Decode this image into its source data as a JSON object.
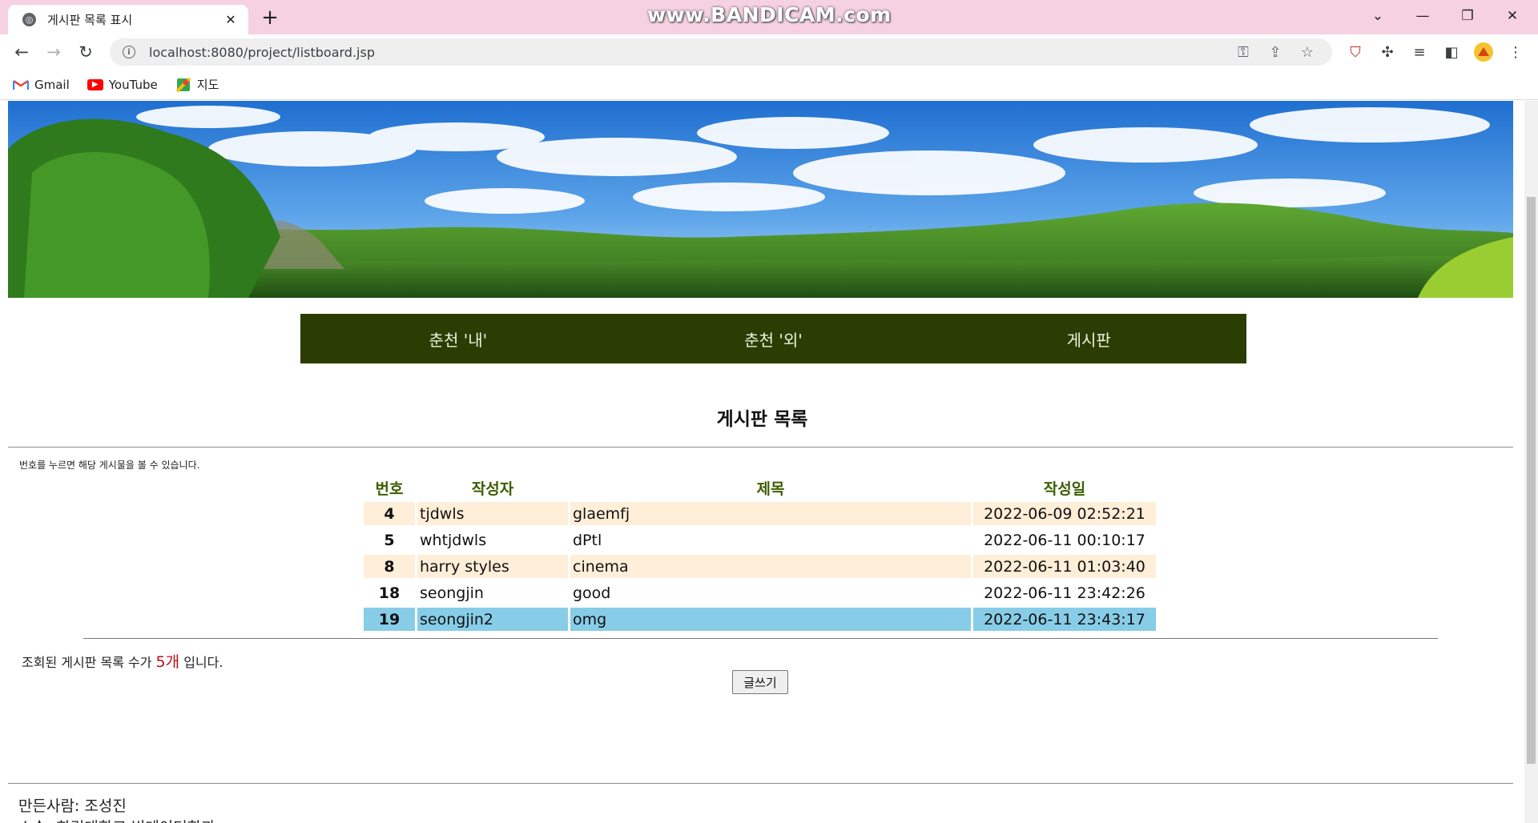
{
  "browser": {
    "tab_title": "게시판 목록 표시",
    "tab_close": "✕",
    "new_tab": "+",
    "watermark": "www.BANDICAM.com",
    "url": "localhost:8080/project/listboard.jsp",
    "window_controls": {
      "dropdown": "⌄",
      "minimize": "—",
      "restore": "❐",
      "close": "✕"
    },
    "nav": {
      "back": "←",
      "forward": "→",
      "reload": "↻"
    },
    "omnibox_icons": [
      "key-icon",
      "share-icon",
      "star-icon"
    ],
    "extension_icons": [
      "shield-extension-icon",
      "puzzle-icon",
      "playlist-icon",
      "sidepanel-icon",
      "profile-avatar-icon",
      "menu-kebab-icon"
    ],
    "bookmarks": [
      {
        "label": "Gmail",
        "icon": "gmail-icon",
        "color": "#ea4335"
      },
      {
        "label": "YouTube",
        "icon": "youtube-icon",
        "color": "#ff0000"
      },
      {
        "label": "지도",
        "icon": "maps-icon",
        "color": "#34a853"
      }
    ]
  },
  "page": {
    "menu": [
      "춘천 '내'",
      "춘천 '외'",
      "게시판"
    ],
    "board_title": "게시판 목록",
    "hint": "번호를 누르면 해당 게시물을 볼 수 있습니다.",
    "table": {
      "headers": {
        "num": "번호",
        "writer": "작성자",
        "subject": "제목",
        "date": "작성일"
      },
      "rows": [
        {
          "num": "4",
          "writer": "tjdwls",
          "subject": "glaemfj",
          "date": "2022-06-09 02:52:21",
          "style": "odd"
        },
        {
          "num": "5",
          "writer": "whtjdwls",
          "subject": "dPtl",
          "date": "2022-06-11 00:10:17",
          "style": "even"
        },
        {
          "num": "8",
          "writer": "harry styles",
          "subject": "cinema",
          "date": "2022-06-11 01:03:40",
          "style": "odd"
        },
        {
          "num": "18",
          "writer": "seongjin",
          "subject": "good",
          "date": "2022-06-11 23:42:26",
          "style": "even"
        },
        {
          "num": "19",
          "writer": "seongjin2",
          "subject": "omg",
          "date": "2022-06-11 23:43:17",
          "style": "highlighted"
        }
      ]
    },
    "count": {
      "prefix": "조회된 게시판 목록 수가 ",
      "value": "5개",
      "suffix": " 입니다."
    },
    "write_button": "글쓰기",
    "footer": {
      "maker": "만든사람: 조성진",
      "affiliation": "소속: 한림대학교 빅데이터학과"
    },
    "colors": {
      "menu_bg": "#2b3d03",
      "header_text": "#3d5e00",
      "row_odd": "#ffeed8",
      "row_highlight": "#87cde8",
      "count_value": "#b3121a"
    }
  }
}
